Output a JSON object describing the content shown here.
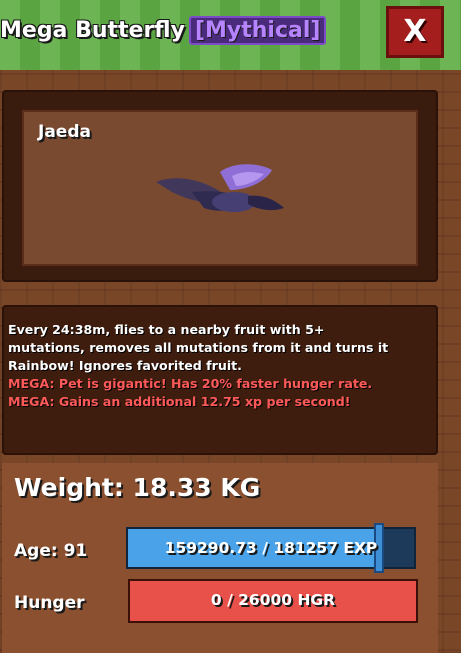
{
  "header": {
    "pet_name": "Mega Butterfly",
    "rarity": "[Mythical]",
    "close_label": "X"
  },
  "preview": {
    "owner": "Jaeda",
    "pet_icon": "butterfly-icon"
  },
  "description": {
    "lines": [
      "Every 24:38m, flies to a nearby fruit with 5+",
      "mutations, removes all mutations from it and turns it",
      "Rainbow! Ignores favorited fruit.",
      "MEGA: Pet is gigantic! Has 20% faster hunger rate.",
      "MEGA: Gains an additional 12.75 xp per second!"
    ]
  },
  "stats": {
    "weight_text": "Weight: 18.33 KG",
    "age_label": "Age: 91",
    "exp_text": "159290.73 / 181257 EXP",
    "exp_current": 159290.73,
    "exp_max": 181257,
    "hunger_label": "Hunger",
    "hunger_text": "0 / 26000 HGR"
  },
  "colors": {
    "header_green": "#5fae45",
    "close_red": "#a51e1e",
    "rarity_purple": "#b784ff",
    "mega_red": "#ff5a5a",
    "exp_blue": "#4aa3e8",
    "hunger_red": "#e8504a"
  }
}
